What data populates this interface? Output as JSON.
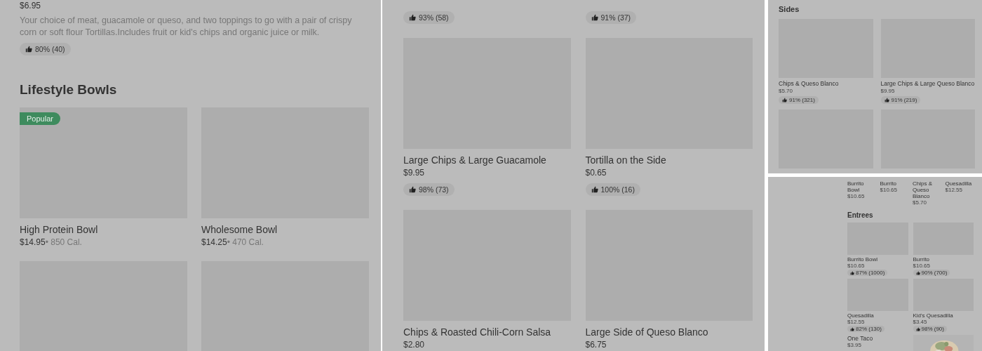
{
  "panels": [
    {
      "kind": "large",
      "blocks": [
        {
          "kind": "lead",
          "price": "$6.95",
          "description": "Your choice of meat, guacamole or queso, and two toppings to go with a pair of crispy corn or soft flour Tortillas.Includes fruit or kid's chips and organic juice or milk.",
          "rating": "80% (40)"
        },
        {
          "kind": "heading",
          "title": "Lifestyle Bowls"
        },
        {
          "kind": "grid",
          "items": [
            {
              "kind": "card",
              "name": "High Protein Bowl",
              "price": "$14.95",
              "calories": "• 850 Cal.",
              "badge": "Popular"
            },
            {
              "kind": "card",
              "name": "Wholesome Bowl",
              "price": "$14.25",
              "calories": "• 470 Cal."
            },
            {
              "kind": "placeholder"
            },
            {
              "kind": "placeholder"
            }
          ]
        }
      ]
    },
    {
      "kind": "large",
      "blocks": [
        {
          "kind": "grid",
          "items": [
            {
              "kind": "tail",
              "rating": "93% (58)"
            },
            {
              "kind": "tail",
              "rating": "91% (37)"
            },
            {
              "kind": "card",
              "name": "Large Chips & Large Guacamole",
              "price": "$9.95",
              "rating": "98% (73)"
            },
            {
              "kind": "card",
              "name": "Tortilla on the Side",
              "price": "$0.65",
              "rating": "100% (16)"
            },
            {
              "kind": "card",
              "name": "Chips & Roasted Chili-Corn Salsa",
              "price": "$2.80"
            },
            {
              "kind": "card",
              "name": "Large Side of Queso Blanco",
              "price": "$6.75"
            }
          ]
        }
      ]
    },
    {
      "kind": "medium",
      "blocks": [
        {
          "kind": "heading",
          "title": "Sides"
        },
        {
          "kind": "grid",
          "items": [
            {
              "kind": "card",
              "name": "Chips & Queso Blanco",
              "price": "$5.70",
              "rating": "91% (321)"
            },
            {
              "kind": "card",
              "name": "Large Chips & Large Queso Blanco",
              "price": "$9.95",
              "rating": "91% (219)"
            },
            {
              "kind": "placeholder"
            },
            {
              "kind": "placeholder"
            }
          ]
        }
      ]
    },
    {
      "kind": "small",
      "blocks": [
        {
          "kind": "strip",
          "items": [
            {
              "name": "Burrito Bowl",
              "price": "$10.65"
            },
            {
              "name": "Burrito",
              "price": "$10.65"
            },
            {
              "name": "Chips & Queso Blanco",
              "price": "$5.70"
            },
            {
              "name": "Quesadilla",
              "price": "$12.55"
            }
          ]
        },
        {
          "kind": "heading",
          "title": "Entrees"
        },
        {
          "kind": "grid",
          "items": [
            {
              "kind": "card",
              "name": "Burrito Bowl",
              "price": "$10.65",
              "rating": "87% (1000)"
            },
            {
              "kind": "card",
              "name": "Burrito",
              "price": "$10.65",
              "rating": "90% (700)"
            },
            {
              "kind": "card",
              "name": "Quesadilla",
              "price": "$12.55",
              "rating": "82% (130)"
            },
            {
              "kind": "card",
              "name": "Kid's Quesadilla",
              "price": "$3.45",
              "rating": "98% (90)"
            }
          ]
        },
        {
          "kind": "row",
          "name": "One Taco",
          "price": "$3.95"
        }
      ]
    }
  ]
}
